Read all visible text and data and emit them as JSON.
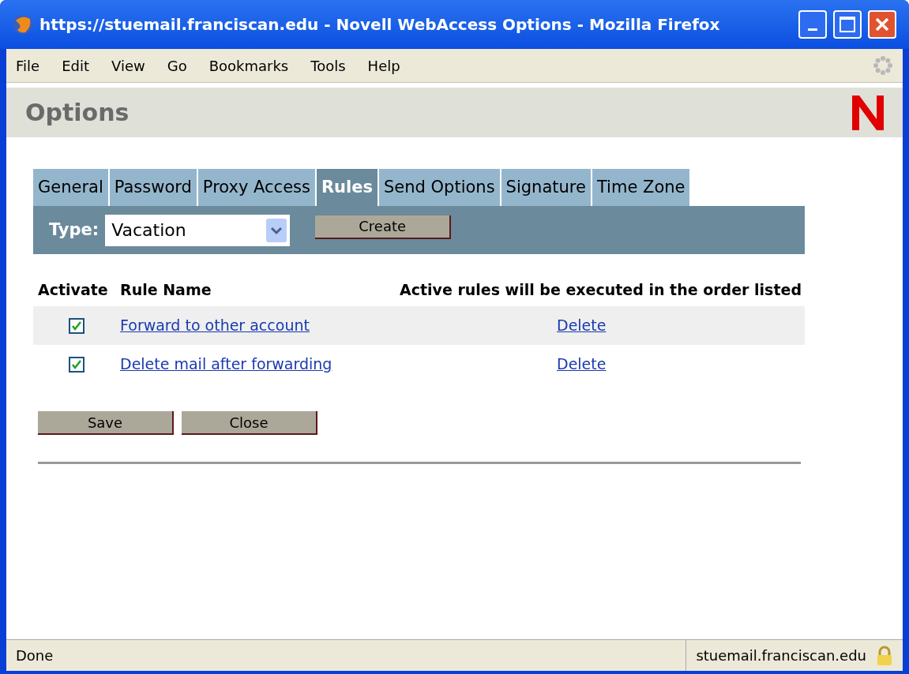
{
  "window": {
    "title": "https://stuemail.franciscan.edu - Novell WebAccess Options - Mozilla Firefox"
  },
  "menu": [
    "File",
    "Edit",
    "View",
    "Go",
    "Bookmarks",
    "Tools",
    "Help"
  ],
  "page_title": "Options",
  "tabs": [
    {
      "label": "General",
      "selected": false
    },
    {
      "label": "Password",
      "selected": false
    },
    {
      "label": "Proxy Access",
      "selected": false
    },
    {
      "label": "Rules",
      "selected": true
    },
    {
      "label": "Send Options",
      "selected": false
    },
    {
      "label": "Signature",
      "selected": false
    },
    {
      "label": "Time Zone",
      "selected": false
    }
  ],
  "type_select": {
    "label": "Type:",
    "value": "Vacation"
  },
  "create_button": "Create",
  "table": {
    "columns": [
      "Activate",
      "Rule Name",
      "Active rules will be executed in the order listed"
    ],
    "rows": [
      {
        "checked": true,
        "name": "Forward to other account",
        "action": "Delete"
      },
      {
        "checked": true,
        "name": "Delete mail after forwarding",
        "action": "Delete"
      }
    ]
  },
  "buttons": [
    "Save",
    "Close"
  ],
  "status_bar": {
    "text": "Done",
    "host": "stuemail.franciscan.edu"
  }
}
